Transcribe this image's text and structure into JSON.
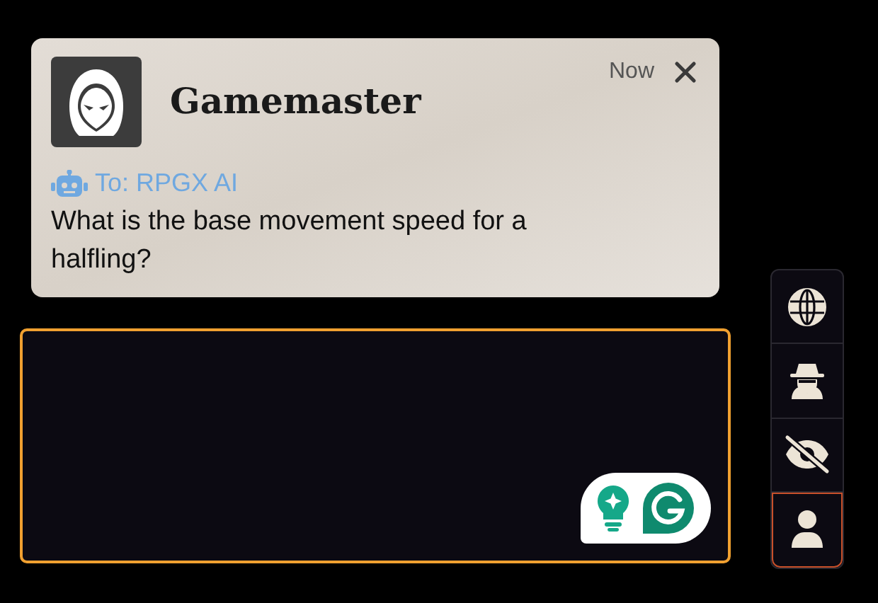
{
  "message": {
    "sender": "Gamemaster",
    "time": "Now",
    "recipient": "To: RPGX AI",
    "body": "What is the base movement speed for a halfling?"
  },
  "side_buttons": [
    {
      "kind": "globe",
      "selected": false
    },
    {
      "kind": "spy",
      "selected": false
    },
    {
      "kind": "eye-slash",
      "selected": false
    },
    {
      "kind": "user",
      "selected": true
    }
  ]
}
